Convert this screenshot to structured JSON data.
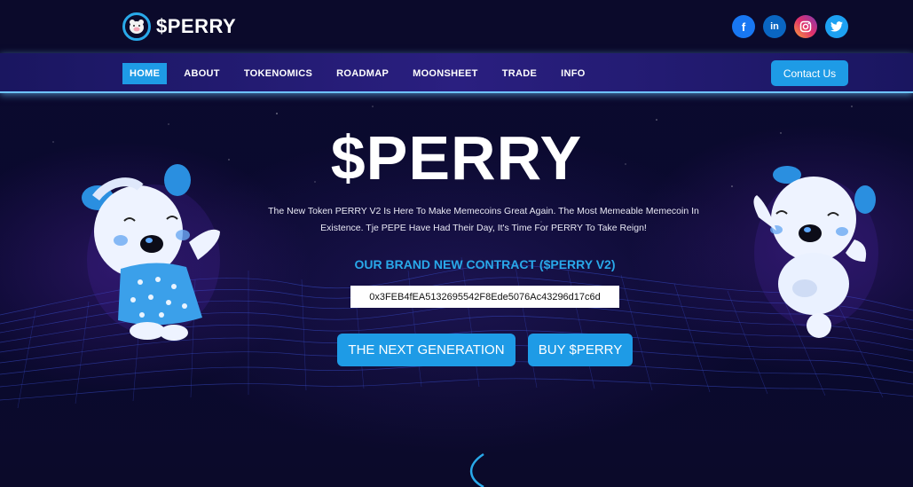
{
  "header": {
    "logo_text": "$PERRY",
    "logo_icon": "pig-face-icon",
    "socials": [
      {
        "name": "facebook",
        "glyph": "f"
      },
      {
        "name": "linkedin",
        "glyph": "in"
      },
      {
        "name": "instagram",
        "glyph": "◎"
      },
      {
        "name": "twitter",
        "glyph": "🐦"
      }
    ]
  },
  "nav": {
    "items": [
      "HOME",
      "ABOUT",
      "TOKENOMICS",
      "ROADMAP",
      "MOONSHEET",
      "TRADE",
      "INFO"
    ],
    "active": "HOME",
    "contact_label": "Contact Us"
  },
  "hero": {
    "title": "$PERRY",
    "description_line1": "The New Token PERRY V2 Is Here To Make Memecoins Great Again. The Most Memeable Memecoin In",
    "description_line2": "Existence. Tje PEPE Have Had Their Day, It's Time For PERRY To Take Reign!",
    "contract_heading": "OUR BRAND NEW CONTRACT ($PERRY V2)",
    "contract_address": "0x3FEB4fEA5132695542F8Ede5076Ac43296d17c6d",
    "btn_generation": "THE NEXT GENERATION",
    "btn_buy": "BUY $PERRY"
  },
  "colors": {
    "accent": "#1e9be6",
    "background": "#0a0a2e",
    "heading_blue": "#29a9ea"
  }
}
